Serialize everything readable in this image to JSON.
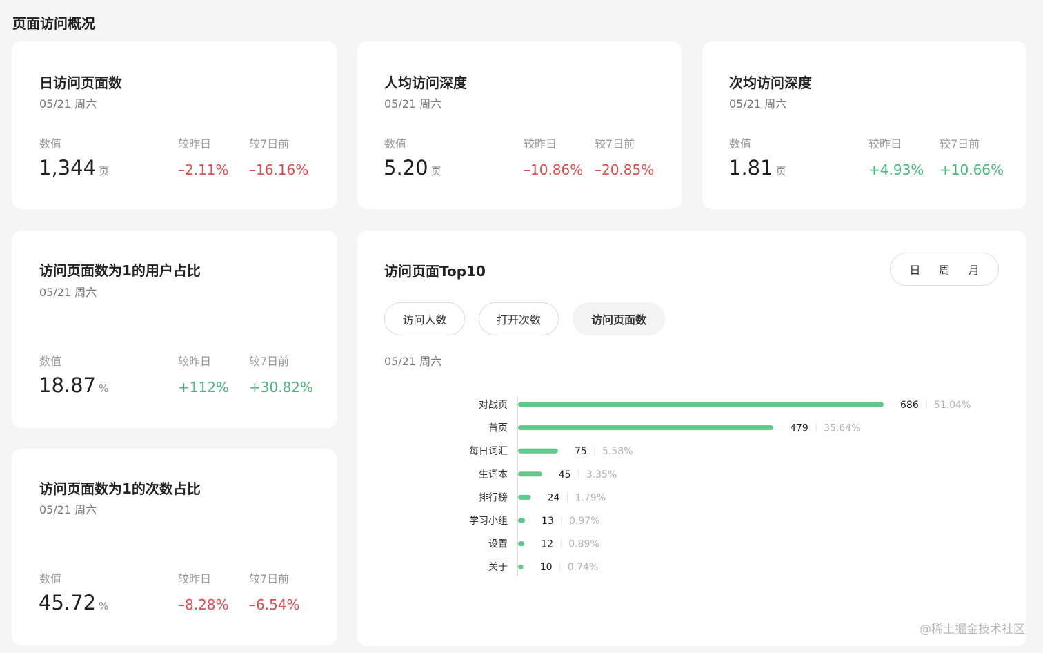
{
  "page_title": "页面访问概况",
  "labels": {
    "value": "数值",
    "vs_yesterday": "较昨日",
    "vs_7days": "较7日前"
  },
  "cards": [
    {
      "title": "日访问页面数",
      "date": "05/21 周六",
      "value": "1,344",
      "unit": "页",
      "vs_yesterday": "–2.11%",
      "vs_7days": "–16.16%"
    },
    {
      "title": "人均访问深度",
      "date": "05/21 周六",
      "value": "5.20",
      "unit": "页",
      "vs_yesterday": "–10.86%",
      "vs_7days": "–20.85%"
    },
    {
      "title": "次均访问深度",
      "date": "05/21 周六",
      "value": "1.81",
      "unit": "页",
      "vs_yesterday": "+4.93%",
      "vs_7days": "+10.66%"
    },
    {
      "title": "访问页面数为1的用户占比",
      "date": "05/21 周六",
      "value": "18.87",
      "unit": "%",
      "vs_yesterday": "+112%",
      "vs_7days": "+30.82%"
    },
    {
      "title": "访问页面数为1的次数占比",
      "date": "05/21 周六",
      "value": "45.72",
      "unit": "%",
      "vs_yesterday": "–8.28%",
      "vs_7days": "–6.54%"
    }
  ],
  "top10": {
    "title": "访问页面Top10",
    "period_options": [
      "日",
      "周",
      "月"
    ],
    "metric_tabs": [
      "访问人数",
      "打开次数",
      "访问页面数"
    ],
    "active_metric": "访问页面数",
    "date": "05/21 周六"
  },
  "colors": {
    "bar": "#5ec98a",
    "negative": "#e5484d",
    "positive": "#46b97a"
  },
  "chart_data": {
    "type": "bar",
    "orientation": "horizontal",
    "categories": [
      "对战页",
      "首页",
      "每日词汇",
      "生词本",
      "排行榜",
      "学习小组",
      "设置",
      "关于"
    ],
    "values": [
      686,
      479,
      75,
      45,
      24,
      13,
      12,
      10
    ],
    "percents": [
      "51.04%",
      "35.64%",
      "5.58%",
      "3.35%",
      "1.79%",
      "0.97%",
      "0.89%",
      "0.74%"
    ]
  },
  "watermark": "@稀土掘金技术社区"
}
